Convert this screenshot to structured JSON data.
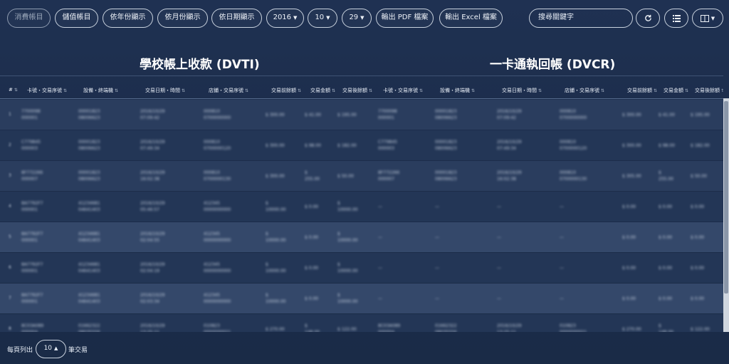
{
  "toolbar": {
    "buttons": [
      "消費帳目",
      "儲值帳目",
      "依年份顯示",
      "依月份顯示",
      "依日期顯示"
    ],
    "year": "2016",
    "month": "10",
    "day": "29",
    "export_pdf": "輸出 PDF 檔案",
    "export_excel": "輸出 Excel 檔案",
    "search_placeholder": "搜尋關鍵字"
  },
  "titles": {
    "left": "學校帳上收款 (DVTI)",
    "right": "一卡通執回帳 (DVCR)"
  },
  "columns": [
    "#",
    "卡號・交易序號",
    "設備・終端機",
    "交易日期・時間",
    "店鋪・交易序號",
    "交易前餘額",
    "交易金額",
    "交易後餘額",
    "卡號・交易序號",
    "設備・終端機",
    "交易日期・時間",
    "店鋪・交易序號",
    "交易前餘額",
    "交易金額",
    "交易後餘額"
  ],
  "rows": [
    {
      "num": "1",
      "c1": [
        "7700098",
        "000001"
      ],
      "c2": [
        "00001823",
        "08006623"
      ],
      "c3": [
        "2016/10/29",
        "07:09:42"
      ],
      "c4": [
        "000810",
        "0700000000"
      ],
      "c5": [
        "$ 300.00"
      ],
      "c6": [
        "$ 41.00"
      ],
      "c7": [
        "$ 195.00"
      ],
      "c8": [
        "7700098",
        "000001"
      ],
      "c9": [
        "00001823",
        "08006623"
      ],
      "c10": [
        "2016/10/29",
        "07:09:42"
      ],
      "c11": [
        "000810",
        "0700000000"
      ],
      "c12": [
        "$ 300.00"
      ],
      "c13": [
        "$ 41.00"
      ],
      "c14": [
        "$ 195.00"
      ]
    },
    {
      "num": "2",
      "c1": [
        "C779845",
        "000003"
      ],
      "c2": [
        "00001823",
        "08006623"
      ],
      "c3": [
        "2016/10/29",
        "07:49:34"
      ],
      "c4": [
        "000810",
        "0700000120"
      ],
      "c5": [
        "$ 300.00"
      ],
      "c6": [
        "$ 98.00"
      ],
      "c7": [
        "$ 182.00"
      ],
      "c8": [
        "C779845",
        "000003"
      ],
      "c9": [
        "00001823",
        "08006623"
      ],
      "c10": [
        "2016/10/29",
        "07:49:34"
      ],
      "c11": [
        "000810",
        "0700000120"
      ],
      "c12": [
        "$ 300.00"
      ],
      "c13": [
        "$ 98.00"
      ],
      "c14": [
        "$ 182.00"
      ]
    },
    {
      "num": "3",
      "c1": [
        "8F772266",
        "000007"
      ],
      "c2": [
        "00001823",
        "08006623"
      ],
      "c3": [
        "2016/10/29",
        "16:02:38"
      ],
      "c4": [
        "000810",
        "0700000130"
      ],
      "c5": [
        "$ 300.00"
      ],
      "c6": [
        "$",
        "255.00"
      ],
      "c7": [
        "$ 50.00"
      ],
      "c8": [
        "8F772266",
        "000007"
      ],
      "c9": [
        "00001823",
        "08006623"
      ],
      "c10": [
        "2016/10/29",
        "16:02:38"
      ],
      "c11": [
        "000810",
        "0700000130"
      ],
      "c12": [
        "$ 305.00"
      ],
      "c13": [
        "$",
        "255.00"
      ],
      "c14": [
        "$ 50.00"
      ]
    },
    {
      "num": "4",
      "c1": [
        "8A7792F7",
        "000001"
      ],
      "c2": [
        "41234681",
        "04641403"
      ],
      "c3": [
        "2016/10/29",
        "05:46:57"
      ],
      "c4": [
        "412345",
        "0000000000"
      ],
      "c5": [
        "$",
        "10000.00"
      ],
      "c6": [
        "$ 0.00"
      ],
      "c7": [
        "$",
        "10000.00"
      ],
      "c8": [
        "—"
      ],
      "c9": [
        "—"
      ],
      "c10": [
        "—"
      ],
      "c11": [
        "—"
      ],
      "c12": [
        "$ 0.00"
      ],
      "c13": [
        "$ 0.00"
      ],
      "c14": [
        "$ 0.00"
      ]
    },
    {
      "num": "5",
      "c1": [
        "8A7792F7",
        "000001"
      ],
      "c2": [
        "41234681",
        "04641403"
      ],
      "c3": [
        "2016/10/29",
        "02:04:55"
      ],
      "c4": [
        "412345",
        "0000000000"
      ],
      "c5": [
        "$",
        "10000.00"
      ],
      "c6": [
        "$ 0.00"
      ],
      "c7": [
        "$",
        "10000.00"
      ],
      "c8": [
        "—"
      ],
      "c9": [
        "—"
      ],
      "c10": [
        "—"
      ],
      "c11": [
        "—"
      ],
      "c12": [
        "$ 0.00"
      ],
      "c13": [
        "$ 0.00"
      ],
      "c14": [
        "$ 0.00"
      ]
    },
    {
      "num": "6",
      "c1": [
        "8A7792F7",
        "000001"
      ],
      "c2": [
        "41234681",
        "04641403"
      ],
      "c3": [
        "2016/10/29",
        "02:04:19"
      ],
      "c4": [
        "412345",
        "0000000000"
      ],
      "c5": [
        "$",
        "10000.00"
      ],
      "c6": [
        "$ 0.00"
      ],
      "c7": [
        "$",
        "10000.00"
      ],
      "c8": [
        "—"
      ],
      "c9": [
        "—"
      ],
      "c10": [
        "—"
      ],
      "c11": [
        "—"
      ],
      "c12": [
        "$ 0.00"
      ],
      "c13": [
        "$ 0.00"
      ],
      "c14": [
        "$ 0.00"
      ]
    },
    {
      "num": "7",
      "c1": [
        "8A7792F7",
        "000001"
      ],
      "c2": [
        "41234681",
        "04641403"
      ],
      "c3": [
        "2016/10/29",
        "02:03:34"
      ],
      "c4": [
        "412345",
        "0000000000"
      ],
      "c5": [
        "$",
        "10000.00"
      ],
      "c6": [
        "$ 0.00"
      ],
      "c7": [
        "$",
        "10000.00"
      ],
      "c8": [
        "—"
      ],
      "c9": [
        "—"
      ],
      "c10": [
        "—"
      ],
      "c11": [
        "—"
      ],
      "c12": [
        "$ 0.00"
      ],
      "c13": [
        "$ 0.00"
      ],
      "c14": [
        "$ 0.00"
      ]
    },
    {
      "num": "8",
      "c1": [
        "8C03A089",
        "000004"
      ],
      "c2": [
        "01662322",
        "08035556"
      ],
      "c3": [
        "2016/10/29",
        "13:25:11"
      ],
      "c4": [
        "010823",
        "0000000021"
      ],
      "c5": [
        "$ 270.00"
      ],
      "c6": [
        "$",
        "148.00"
      ],
      "c7": [
        "$ 122.00"
      ],
      "c8": [
        "8C03A089",
        "000004"
      ],
      "c9": [
        "01662322",
        "08035556"
      ],
      "c10": [
        "2016/10/29",
        "13:25:11"
      ],
      "c11": [
        "010823",
        "0000000021"
      ],
      "c12": [
        "$ 270.00"
      ],
      "c13": [
        "$",
        "148.00"
      ],
      "c14": [
        "$ 122.00"
      ]
    }
  ],
  "footer": {
    "prefix": "每頁列出",
    "page_size": "10",
    "suffix": "筆交易"
  }
}
